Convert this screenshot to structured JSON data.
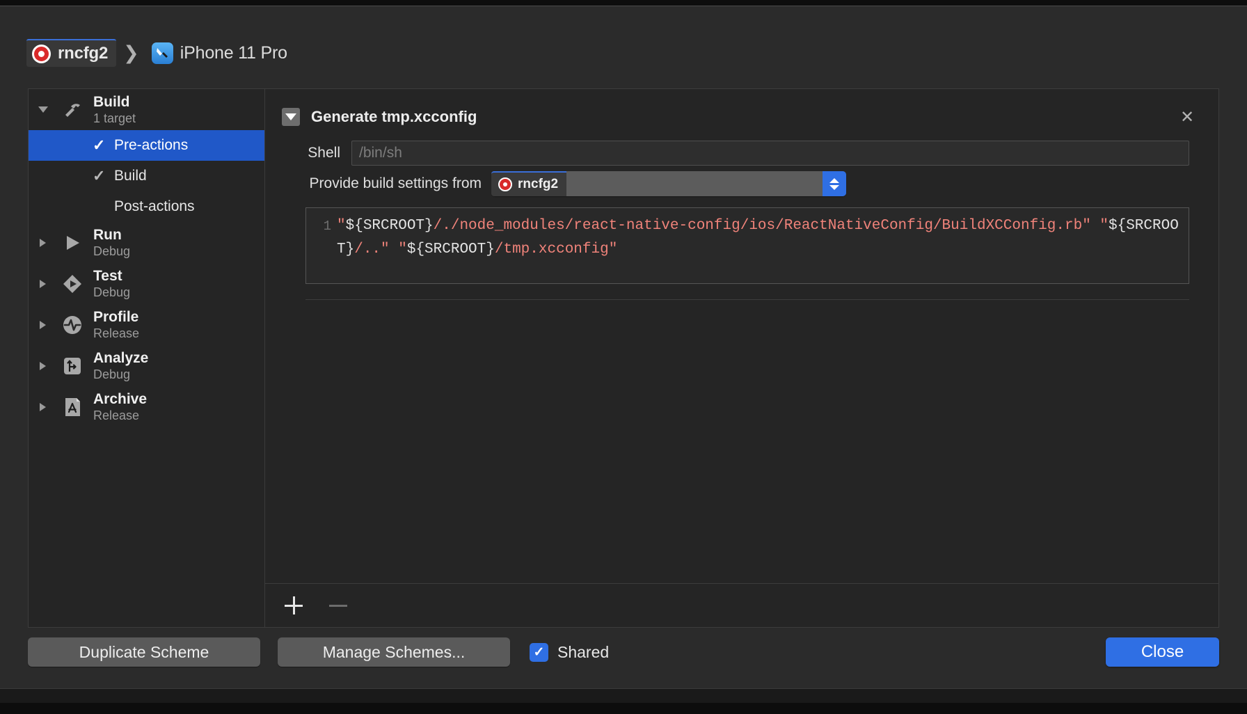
{
  "breadcrumb": {
    "scheme": "rncfg2",
    "separator": "❯",
    "destination": "iPhone 11 Pro",
    "scheme_icon": "target-icon",
    "destination_icon": "xcode-device-icon"
  },
  "sidebar": {
    "groups": [
      {
        "title": "Build",
        "subtitle": "1 target",
        "icon": "hammer-icon",
        "expanded": true,
        "children": [
          {
            "label": "Pre-actions",
            "checked": true,
            "selected": true
          },
          {
            "label": "Build",
            "checked": true,
            "selected": false
          },
          {
            "label": "Post-actions",
            "checked": false,
            "selected": false
          }
        ]
      },
      {
        "title": "Run",
        "subtitle": "Debug",
        "icon": "play-icon",
        "expanded": false,
        "children": []
      },
      {
        "title": "Test",
        "subtitle": "Debug",
        "icon": "test-diamond-icon",
        "expanded": false,
        "children": []
      },
      {
        "title": "Profile",
        "subtitle": "Release",
        "icon": "profile-waveform-icon",
        "expanded": false,
        "children": []
      },
      {
        "title": "Analyze",
        "subtitle": "Debug",
        "icon": "analyze-branch-icon",
        "expanded": false,
        "children": []
      },
      {
        "title": "Archive",
        "subtitle": "Release",
        "icon": "archive-appstore-icon",
        "expanded": false,
        "children": []
      }
    ]
  },
  "action": {
    "title": "Generate tmp.xcconfig",
    "disclosure_icon": "triangle-down-icon",
    "close_icon": "close-icon",
    "shell": {
      "label": "Shell",
      "value": "",
      "placeholder": "/bin/sh"
    },
    "build_settings": {
      "label": "Provide build settings from",
      "value": "rncfg2",
      "value_icon": "target-icon",
      "stepper_icon": "chevron-up-down-icon"
    },
    "editor": {
      "line_number": "1",
      "script": "\"${SRCROOT}/./node_modules/react-native-config/ios/ReactNativeConfig/BuildXCConfig.rb\" \"${SRCROOT}/..\" \"${SRCROOT}/tmp.xcconfig\"",
      "tokens": [
        {
          "text": "\"",
          "kind": "str"
        },
        {
          "text": "${SRCROOT}",
          "kind": "var"
        },
        {
          "text": "/./node_modules/react-native-config/ios/ReactNativeConfig/BuildXCConfig.rb\" \"",
          "kind": "str"
        },
        {
          "text": "${SRCROOT}",
          "kind": "var"
        },
        {
          "text": "/..\" \"",
          "kind": "str"
        },
        {
          "text": "${SRCROOT}",
          "kind": "var"
        },
        {
          "text": "/tmp.xcconfig\"",
          "kind": "str"
        }
      ]
    },
    "add_label": "+",
    "remove_label": "−"
  },
  "footer": {
    "duplicate_scheme": "Duplicate Scheme",
    "manage_schemes": "Manage Schemes...",
    "shared_label": "Shared",
    "shared_checked": true,
    "shared_checkmark": "✓",
    "close": "Close"
  },
  "colors": {
    "accent_blue": "#2f6fe4",
    "selection_blue": "#2058c8",
    "target_red": "#d92b2b",
    "code_string": "#f0837a",
    "code_variable": "#e3e3e3",
    "window_bg": "#2b2b2b",
    "panel_bg": "#252525"
  }
}
